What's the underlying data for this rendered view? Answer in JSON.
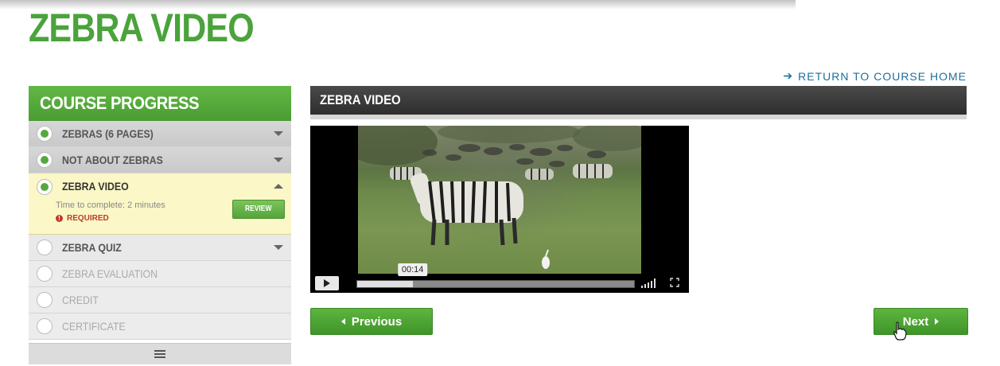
{
  "page": {
    "title": "ZEBRA VIDEO"
  },
  "return_link": {
    "label": "RETURN TO COURSE HOME",
    "icon": "arrow-left-icon"
  },
  "sidebar": {
    "title": "COURSE PROGRESS",
    "items": [
      {
        "label": "ZEBRAS (6 PAGES)",
        "status": "complete"
      },
      {
        "label": "NOT ABOUT ZEBRAS",
        "status": "complete"
      },
      {
        "label": "ZEBRA VIDEO",
        "status": "current",
        "time_to_complete": "Time to complete: 2 minutes",
        "required": "REQUIRED",
        "action": "REVIEW"
      },
      {
        "label": "ZEBRA QUIZ",
        "status": "incomplete"
      },
      {
        "label": "ZEBRA EVALUATION",
        "status": "locked"
      },
      {
        "label": "CREDIT",
        "status": "locked"
      },
      {
        "label": "CERTIFICATE",
        "status": "locked"
      }
    ],
    "footer_icon": "menu-icon"
  },
  "main": {
    "header": "ZEBRA VIDEO",
    "video": {
      "current_time": "00:14",
      "progress": 0.2,
      "play_icon": "play-icon",
      "volume_icon": "volume-icon",
      "fullscreen_icon": "fullscreen-icon"
    },
    "prev_label": "Previous",
    "next_label": "Next"
  },
  "colors": {
    "brand_green": "#4aa33b",
    "header_dark": "#333333",
    "link_blue": "#1f6f9a",
    "active_item_bg": "#fbf7c6",
    "required_red": "#c0392b"
  }
}
